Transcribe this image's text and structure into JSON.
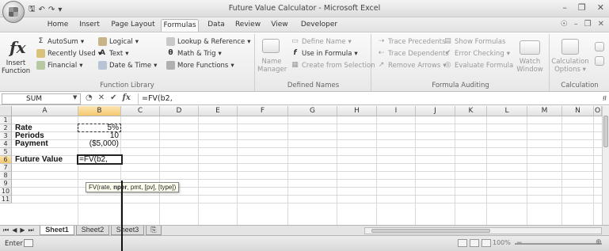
{
  "window": {
    "title": "Future Value Calculator - Microsoft Excel"
  },
  "ribbon_tabs": [
    "Home",
    "Insert",
    "Page Layout",
    "Formulas",
    "Data",
    "Review",
    "View",
    "Developer"
  ],
  "active_tab": "Formulas",
  "ribbon": {
    "function_library": {
      "label": "Function Library",
      "insert_function": "Insert Function",
      "autosum": "AutoSum",
      "recently_used": "Recently Used",
      "financial": "Financial",
      "logical": "Logical",
      "text": "Text",
      "date_time": "Date & Time",
      "lookup_reference": "Lookup & Reference",
      "math_trig": "Math & Trig",
      "more_functions": "More Functions"
    },
    "defined_names": {
      "label": "Defined Names",
      "name_manager": "Name Manager",
      "define_name": "Define Name",
      "use_in_formula": "Use in Formula",
      "create_from_selection": "Create from Selection"
    },
    "formula_auditing": {
      "label": "Formula Auditing",
      "trace_precedents": "Trace Precedents",
      "trace_dependents": "Trace Dependents",
      "remove_arrows": "Remove Arrows",
      "show_formulas": "Show Formulas",
      "error_checking": "Error Checking",
      "evaluate_formula": "Evaluate Formula",
      "watch_window": "Watch Window"
    },
    "calculation": {
      "label": "Calculation",
      "calculation_options": "Calculation Options"
    }
  },
  "formula_bar": {
    "name_box": "SUM",
    "content": "=FV(b2,"
  },
  "columns": [
    "A",
    "B",
    "C",
    "D",
    "E",
    "F",
    "G",
    "H",
    "I",
    "J",
    "K",
    "L",
    "M",
    "N",
    "O"
  ],
  "rows": [
    "1",
    "2",
    "3",
    "4",
    "5",
    "6",
    "7",
    "8",
    "9",
    "10",
    "11"
  ],
  "cells": {
    "A2": "Rate",
    "B2": "5%",
    "A3": "Periods",
    "B3": "10",
    "A4": "Payment",
    "B4": "($5,000)",
    "A6": "Future Value",
    "B6": "=FV(b2,"
  },
  "tooltip": {
    "before": "FV(rate, ",
    "current": "nper",
    "after": ", pmt, [pv], [type])"
  },
  "sheet_tabs": [
    "Sheet1",
    "Sheet2",
    "Sheet3"
  ],
  "active_sheet": "Sheet1",
  "status": {
    "mode": "Enter",
    "zoom": "100%"
  }
}
